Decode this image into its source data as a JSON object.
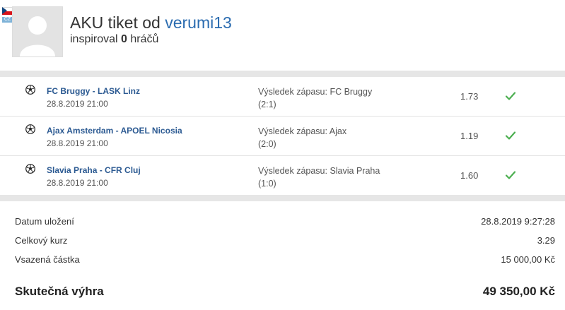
{
  "header": {
    "flag_icon": "czech-flag",
    "country_code": "CZ",
    "title_prefix": "AKU tiket od",
    "username": "verumi13",
    "inspired_prefix": "inspiroval",
    "inspired_count": "0",
    "inspired_suffix": "hráčů"
  },
  "matches": [
    {
      "teams": "FC Bruggy - LASK Linz",
      "date": "28.8.2019 21:00",
      "result_line1": "Výsledek zápasu: FC Bruggy",
      "result_line2": "(2:1)",
      "odds": "1.73",
      "status": "win"
    },
    {
      "teams": "Ajax Amsterdam - APOEL Nicosia",
      "date": "28.8.2019 21:00",
      "result_line1": "Výsledek zápasu: Ajax",
      "result_line2": "(2:0)",
      "odds": "1.19",
      "status": "win"
    },
    {
      "teams": "Slavia Praha - CFR Cluj",
      "date": "28.8.2019 21:00",
      "result_line1": "Výsledek zápasu: Slavia Praha",
      "result_line2": "(1:0)",
      "odds": "1.60",
      "status": "win"
    }
  ],
  "summary": {
    "saved_label": "Datum uložení",
    "saved_value": "28.8.2019 9:27:28",
    "total_odds_label": "Celkový kurz",
    "total_odds_value": "3.29",
    "stake_label": "Vsazená částka",
    "stake_value": "15 000,00 Kč",
    "win_label": "Skutečná výhra",
    "win_value": "49 350,00 Kč"
  },
  "colors": {
    "link_blue": "#2c5a92",
    "check_green": "#4caf50",
    "band_gray": "#e6e6e6"
  }
}
